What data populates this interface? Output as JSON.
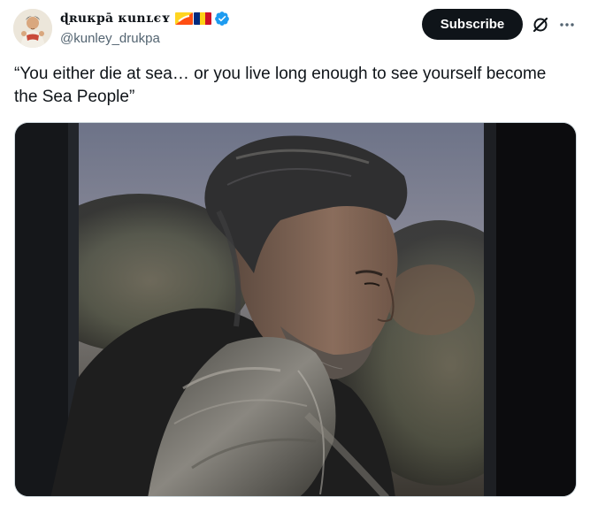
{
  "author": {
    "display_name": "ɖʀuκpā κunʟєʏ",
    "handle": "@kunley_drukpa",
    "flags": [
      "bhutan-flag",
      "romania-flag"
    ],
    "verified": true
  },
  "actions": {
    "subscribe_label": "Subscribe",
    "grok_icon": "grok-icon",
    "more_icon": "more-icon"
  },
  "tweet": {
    "text": "“You either die at sea… or you live long enough to see yourself become the Sea People”"
  },
  "media": {
    "type": "video-still",
    "description_icon": "media-image"
  },
  "colors": {
    "text": "#0f1419",
    "secondary": "#536471",
    "button_bg": "#0f1419",
    "verified": "#1d9bf0"
  }
}
